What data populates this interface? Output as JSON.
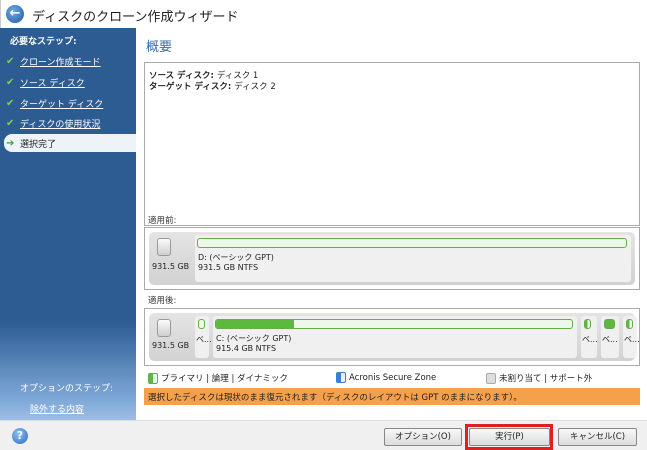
{
  "window": {
    "title": "ディスクのクローン作成ウィザード"
  },
  "sidebar": {
    "required_heading": "必要なステップ:",
    "steps": [
      {
        "label": "クローン作成モード",
        "status": "done"
      },
      {
        "label": "ソース ディスク",
        "status": "done"
      },
      {
        "label": "ターゲット ディスク",
        "status": "done"
      },
      {
        "label": "ディスクの使用状況",
        "status": "done"
      },
      {
        "label": "選択完了",
        "status": "current"
      }
    ],
    "optional_heading": "オプションのステップ:",
    "optional_link": "除外する内容"
  },
  "main": {
    "title": "概要",
    "summary": {
      "source_label": "ソース ディスク:",
      "source_value": "ディスク 1",
      "target_label": "ターゲット ディスク:",
      "target_value": "ディスク 2"
    },
    "before": {
      "label": "適用前:",
      "disk_size": "931.5 GB",
      "partition": {
        "name": "D: (ベーシック GPT)",
        "detail": "931.5 GB  NTFS",
        "used_fraction": 0.0
      }
    },
    "after": {
      "label": "適用後:",
      "disk_size": "931.5 GB",
      "small_label": "ベ...",
      "partition": {
        "name": "C: (ベーシック GPT)",
        "detail": "915.4 GB  NTFS",
        "used_fraction": 0.22
      }
    },
    "legend": {
      "primary": "プライマリ | 論理 | ダイナミック",
      "asz": "Acronis Secure Zone",
      "unalloc": "未割り当て | サポート外"
    },
    "message": "選択したディスクは現状のまま復元されます（ディスクのレイアウトは GPT のままになります）。"
  },
  "buttons": {
    "options": "オプション(O)",
    "proceed": "実行(P)",
    "cancel": "キャンセル(C)"
  },
  "colors": {
    "accent": "#2d5c93",
    "warning": "#f5a04a",
    "highlight": "#e02020"
  }
}
